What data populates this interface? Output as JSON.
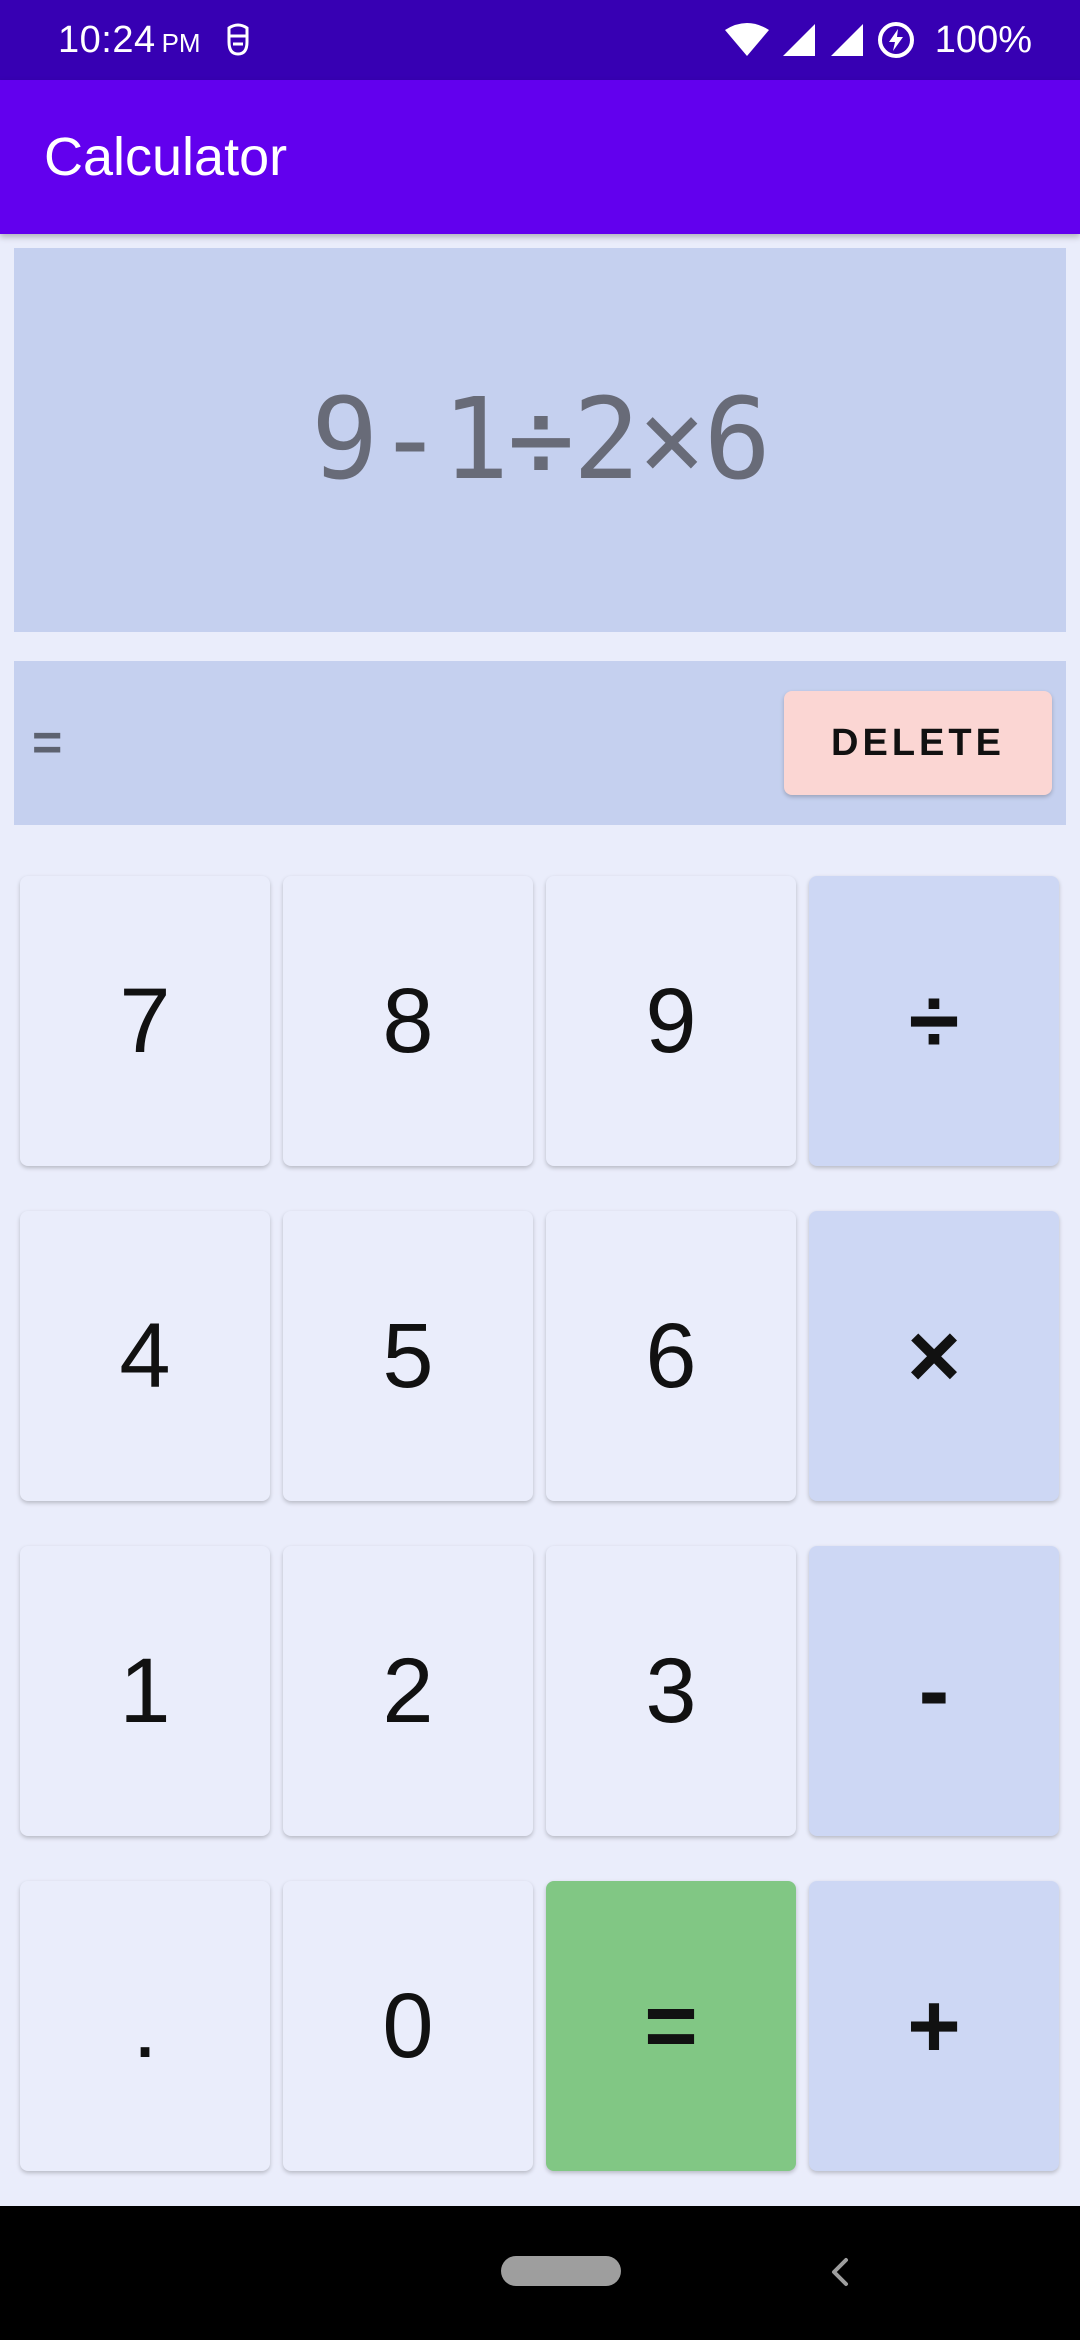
{
  "status_bar": {
    "time": "10:24",
    "ampm": "PM",
    "battery": "100%",
    "icons": [
      "notification-icon",
      "wifi-icon",
      "signal-icon",
      "signal-icon",
      "battery-saver-icon"
    ]
  },
  "app_bar": {
    "title": "Calculator"
  },
  "display": {
    "expression": "9-1÷2×6",
    "result_prefix": "=",
    "delete_label": "DELETE"
  },
  "keypad": {
    "rows": [
      [
        {
          "label": "7"
        },
        {
          "label": "8"
        },
        {
          "label": "9"
        },
        {
          "label": "÷"
        }
      ],
      [
        {
          "label": "4"
        },
        {
          "label": "5"
        },
        {
          "label": "6"
        },
        {
          "label": "×"
        }
      ],
      [
        {
          "label": "1"
        },
        {
          "label": "2"
        },
        {
          "label": "3"
        },
        {
          "label": "-"
        }
      ],
      [
        {
          "label": "."
        },
        {
          "label": "0"
        },
        {
          "label": "="
        },
        {
          "label": "+"
        }
      ]
    ]
  },
  "colors": {
    "status_bar": "#3700b3",
    "app_bar": "#6200ee",
    "display_panel": "#c5d0ef",
    "delete_button": "#fbd6d3",
    "digit_key": "#eaedfb",
    "operator_key": "#cdd7f4",
    "equals_key": "#81c784"
  },
  "nav_bar": {
    "icons": [
      "home-pill-icon",
      "back-icon"
    ]
  }
}
